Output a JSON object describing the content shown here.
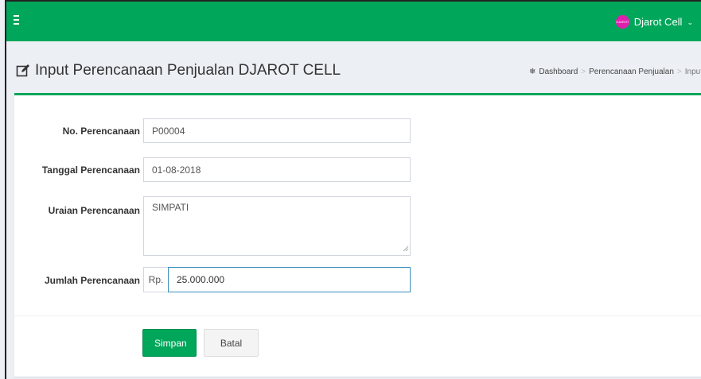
{
  "app": {
    "user_name": "Djarot Cell",
    "avatar_text": "DJAROT CELL",
    "brand_color": "#00a65a",
    "avatar_color": "#e01fae"
  },
  "header": {
    "title": "Input Perencanaan Penjualan DJAROT CELL",
    "breadcrumb": [
      "Dashboard",
      "Perencanaan Penjualan",
      "Input"
    ]
  },
  "form": {
    "no_label": "No. Perencanaan",
    "no_value": "P00004",
    "tanggal_label": "Tanggal Perencanaan",
    "tanggal_value": "01-08-2018",
    "uraian_label": "Uraian Perencanaan",
    "uraian_value": "SIMPATI",
    "jumlah_label": "Jumlah Perencanaan",
    "jumlah_prefix": "Rp.",
    "jumlah_value": "25.000.000"
  },
  "buttons": {
    "save": "Simpan",
    "cancel": "Batal"
  }
}
